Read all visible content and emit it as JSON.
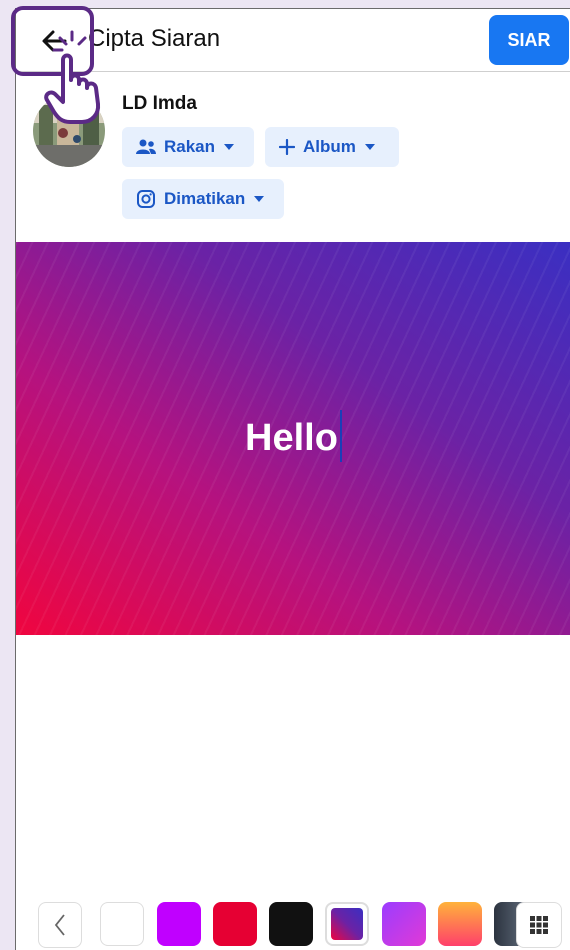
{
  "header": {
    "title": "Cipta Siaran",
    "post_label": "SIAR"
  },
  "profile": {
    "name": "LD Imda"
  },
  "chips": {
    "friends": "Rakan",
    "album": "Album",
    "instagram": "Dimatikan"
  },
  "canvas": {
    "text": "Hello"
  },
  "palette": {
    "swatches": [
      "#ffffff",
      "#c000ff",
      "#e60033",
      "#111111",
      "gradient-red-purple",
      "gradient-purple-violet",
      "gradient-orange-pink",
      "gradient-dark"
    ]
  },
  "colors": {
    "accent": "#1877f2",
    "chip_bg": "#e7f0fd",
    "chip_text": "#1b57c5",
    "gesture": "#5b2a86"
  }
}
